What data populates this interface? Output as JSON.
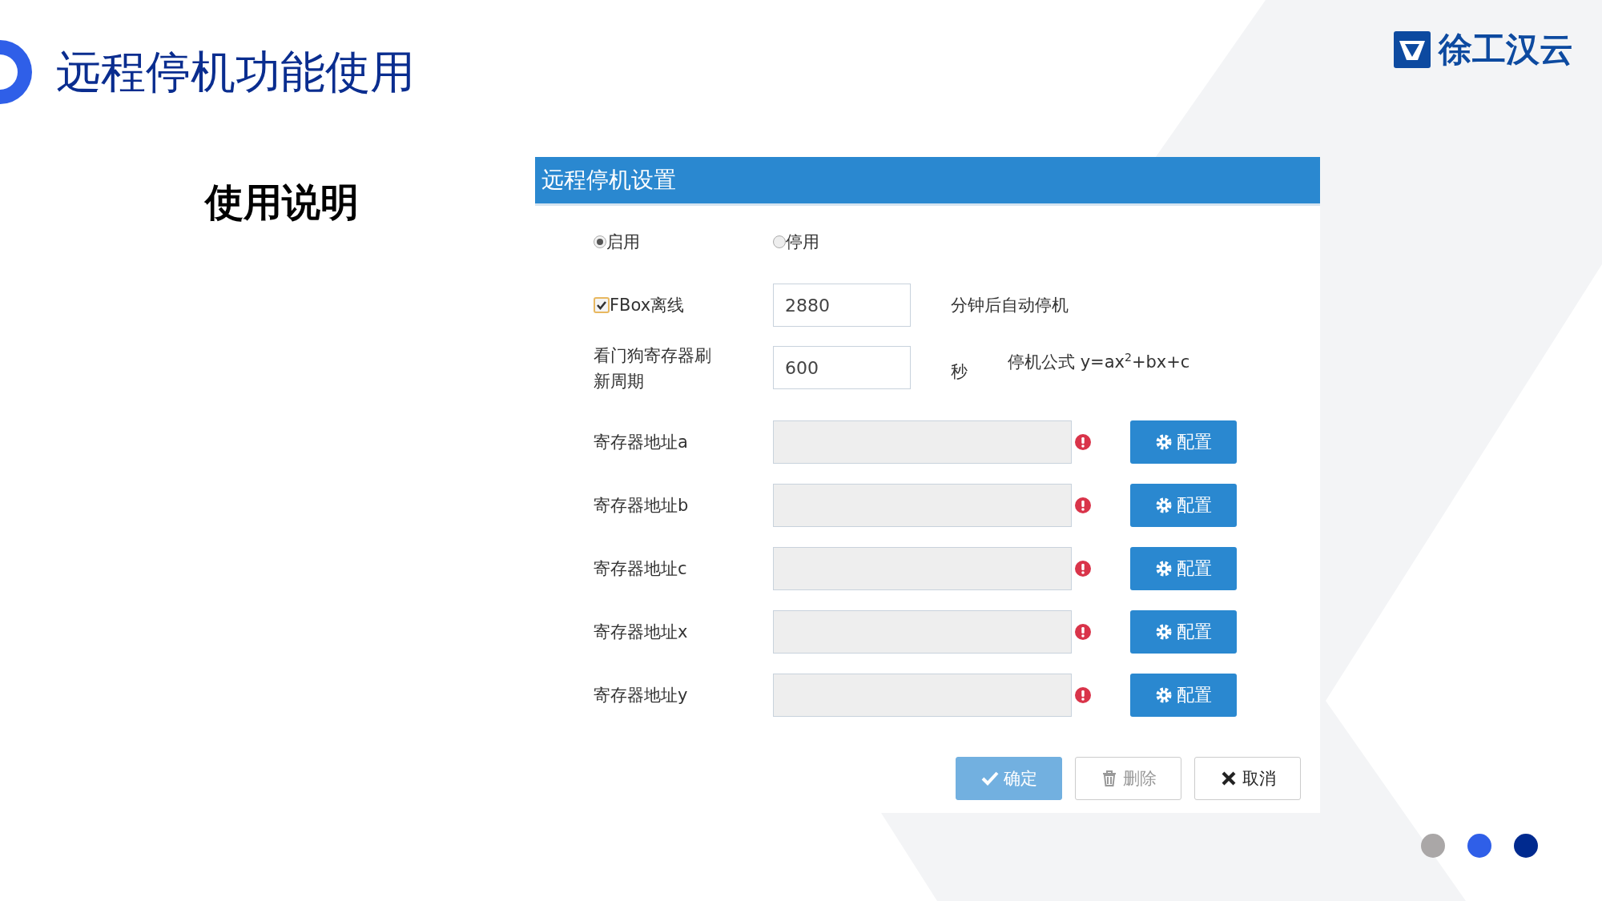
{
  "slide": {
    "title": "远程停机功能使用",
    "subtitle": "使用说明",
    "logo": "徐工汉云"
  },
  "dialog": {
    "title": "远程停机设置",
    "mode": [
      {
        "label": "启用",
        "selected": true
      },
      {
        "label": "停用",
        "selected": false
      }
    ],
    "offline": {
      "label": "FBox离线",
      "checked": true,
      "value": "2880",
      "suffix": "分钟后自动停机"
    },
    "watchdog": {
      "label": "看门狗寄存器刷新周期",
      "value": "600",
      "suffix": "秒",
      "formula": "停机公式 y=ax$^{2}$+bx+c"
    },
    "registers": [
      {
        "label": "寄存器地址a",
        "button": "配置"
      },
      {
        "label": "寄存器地址b",
        "button": "配置"
      },
      {
        "label": "寄存器地址c",
        "button": "配置"
      },
      {
        "label": "寄存器地址x",
        "button": "配置"
      },
      {
        "label": "寄存器地址y",
        "button": "配置"
      }
    ],
    "buttons": [
      {
        "kind": "confirm",
        "label": "确定",
        "disabled": true
      },
      {
        "kind": "delete",
        "label": "删除",
        "disabled": true
      },
      {
        "kind": "cancel",
        "label": "取消",
        "disabled": false
      }
    ]
  },
  "dots": [
    {
      "color": "#aaa7a7"
    },
    {
      "color": "#2f5fe8"
    },
    {
      "color": "#002a8f"
    }
  ]
}
